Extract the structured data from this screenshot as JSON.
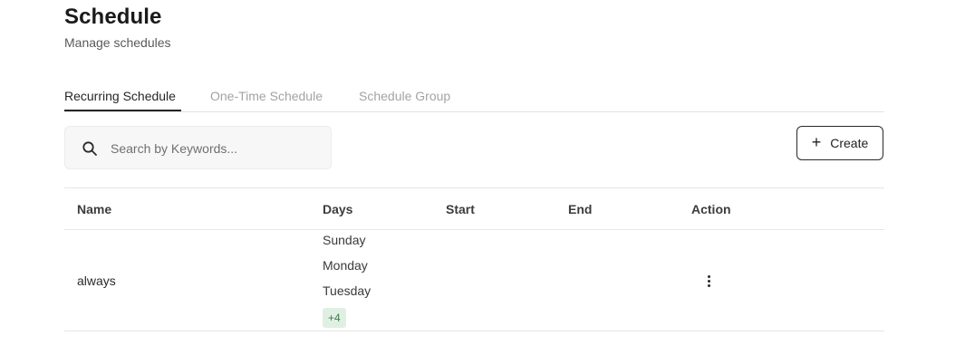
{
  "header": {
    "title": "Schedule",
    "subtitle": "Manage schedules"
  },
  "tabs": [
    {
      "label": "Recurring Schedule",
      "active": true
    },
    {
      "label": "One-Time Schedule",
      "active": false
    },
    {
      "label": "Schedule Group",
      "active": false
    }
  ],
  "search": {
    "placeholder": "Search by Keywords...",
    "value": "",
    "icon": "search-icon"
  },
  "toolbar": {
    "create_label": "Create",
    "create_icon": "plus-icon"
  },
  "table": {
    "columns": [
      "Name",
      "Days",
      "Start",
      "End",
      "Action"
    ],
    "rows": [
      {
        "name": "always",
        "days": [
          "Sunday",
          "Monday",
          "Tuesday"
        ],
        "more_days": "+4",
        "start": "",
        "end": "",
        "action_icon": "more-vertical-icon"
      }
    ]
  },
  "colors": {
    "text_primary": "#1a1a1a",
    "tab_inactive": "#a3a3a3",
    "badge_bg": "#dff0e3",
    "badge_text": "#3e7a4d",
    "border": "#e6e6e6"
  }
}
